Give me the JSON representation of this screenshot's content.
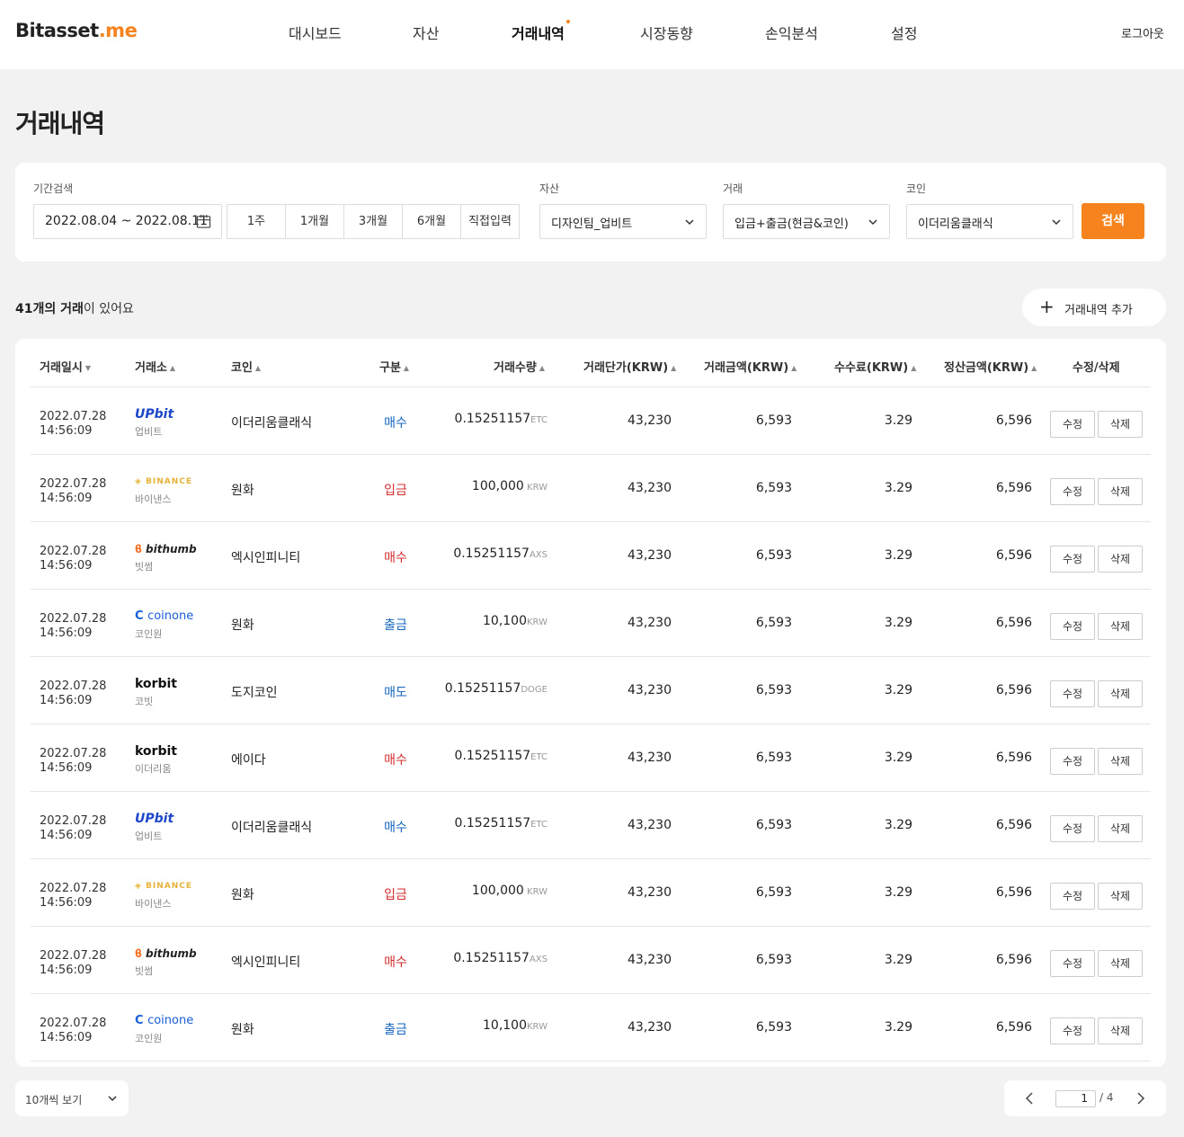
{
  "brand": {
    "name": "Bitasset",
    "tld": ".me"
  },
  "nav": [
    {
      "label": "대시보드"
    },
    {
      "label": "자산"
    },
    {
      "label": "거래내역"
    },
    {
      "label": "시장동향"
    },
    {
      "label": "손익분석"
    },
    {
      "label": "설정"
    }
  ],
  "logout_label": "로그아웃",
  "page_title": "거래내역",
  "filters": {
    "period_label": "기간검색",
    "date_range": "2022.08.04 ~ 2022.08.11",
    "period_buttons": [
      "1주",
      "1개월",
      "3개월",
      "6개월",
      "직접입력"
    ],
    "asset_label": "자산",
    "asset_value": "디자인팀_업비트",
    "trade_label": "거래",
    "trade_value": "입금+출금(현금&코인)",
    "coin_label": "코인",
    "coin_value": "이더리움클래식",
    "search_label": "검색"
  },
  "summary": {
    "count_bold": "41개의 거래",
    "count_rest": "이 있어요"
  },
  "add_button_label": "거래내역 추가",
  "table": {
    "headers": [
      "거래일시",
      "거래소",
      "코인",
      "구분",
      "거래수량",
      "거래단가(KRW)",
      "거래금액(KRW)",
      "수수료(KRW)",
      "정산금액(KRW)",
      "수정/삭제"
    ],
    "sort_down": "▼",
    "sort_up": "▲",
    "edit_label": "수정",
    "delete_label": "삭제",
    "rows": [
      {
        "date": "2022.07.28",
        "time": "14:56:09",
        "ex_logo": "UPbit",
        "ex_name": "업비트",
        "coin": "이더리움클래식",
        "type": "매수",
        "qty": "0.15251157",
        "unit": "ETC",
        "price": "43,230",
        "amount": "6,593",
        "fee": "3.29",
        "settle": "6,596"
      },
      {
        "date": "2022.07.28",
        "time": "14:56:09",
        "ex_logo": "BINANCE",
        "ex_name": "바이낸스",
        "coin": "원화",
        "type": "입금",
        "qty": "100,000",
        "unit": " KRW",
        "price": "43,230",
        "amount": "6,593",
        "fee": "3.29",
        "settle": "6,596"
      },
      {
        "date": "2022.07.28",
        "time": "14:56:09",
        "ex_logo": "bithumb",
        "ex_name": "빗썸",
        "coin": "엑시인피니티",
        "type": "매수",
        "qty": "0.15251157",
        "unit": "AXS",
        "price": "43,230",
        "amount": "6,593",
        "fee": "3.29",
        "settle": "6,596"
      },
      {
        "date": "2022.07.28",
        "time": "14:56:09",
        "ex_logo": "coinone",
        "ex_name": "코인원",
        "coin": "원화",
        "type": "출금",
        "qty": "10,100",
        "unit": "KRW",
        "price": "43,230",
        "amount": "6,593",
        "fee": "3.29",
        "settle": "6,596"
      },
      {
        "date": "2022.07.28",
        "time": "14:56:09",
        "ex_logo": "korbit",
        "ex_name": "코빗",
        "coin": "도지코인",
        "type": "매도",
        "qty": "0.15251157",
        "unit": "DOGE",
        "price": "43,230",
        "amount": "6,593",
        "fee": "3.29",
        "settle": "6,596"
      },
      {
        "date": "2022.07.28",
        "time": "14:56:09",
        "ex_logo": "korbit",
        "ex_name": "이더리움",
        "coin": "에이다",
        "type": "매수",
        "qty": "0.15251157",
        "unit": "ETC",
        "price": "43,230",
        "amount": "6,593",
        "fee": "3.29",
        "settle": "6,596"
      },
      {
        "date": "2022.07.28",
        "time": "14:56:09",
        "ex_logo": "UPbit",
        "ex_name": "업비트",
        "coin": "이더리움클래식",
        "type": "매수",
        "qty": "0.15251157",
        "unit": "ETC",
        "price": "43,230",
        "amount": "6,593",
        "fee": "3.29",
        "settle": "6,596"
      },
      {
        "date": "2022.07.28",
        "time": "14:56:09",
        "ex_logo": "BINANCE",
        "ex_name": "바이낸스",
        "coin": "원화",
        "type": "입금",
        "qty": "100,000",
        "unit": " KRW",
        "price": "43,230",
        "amount": "6,593",
        "fee": "3.29",
        "settle": "6,596"
      },
      {
        "date": "2022.07.28",
        "time": "14:56:09",
        "ex_logo": "bithumb",
        "ex_name": "빗썸",
        "coin": "엑시인피니티",
        "type": "매수",
        "qty": "0.15251157",
        "unit": "AXS",
        "price": "43,230",
        "amount": "6,593",
        "fee": "3.29",
        "settle": "6,596"
      },
      {
        "date": "2022.07.28",
        "time": "14:56:09",
        "ex_logo": "coinone",
        "ex_name": "코인원",
        "coin": "원화",
        "type": "출금",
        "qty": "10,100",
        "unit": "KRW",
        "price": "43,230",
        "amount": "6,593",
        "fee": "3.29",
        "settle": "6,596"
      }
    ]
  },
  "type_colors": {
    "매수": "blue",
    "매도": "blue",
    "출금": "blue",
    "입금": "red"
  },
  "row_type_overrides": [
    "blue",
    "red",
    "red",
    "blue",
    "blue",
    "red",
    "blue",
    "red",
    "red",
    "blue"
  ],
  "colors": {
    "accent": "#f7831e",
    "buy_blue": "#1565c0",
    "red": "#d32f2f",
    "upbit": "#1d47c8",
    "binance": "#e6b33a",
    "coinone": "#1a5ed8"
  },
  "page_size_label": "10개씩 보기",
  "pagination": {
    "current": "1",
    "total": "/ 4"
  }
}
